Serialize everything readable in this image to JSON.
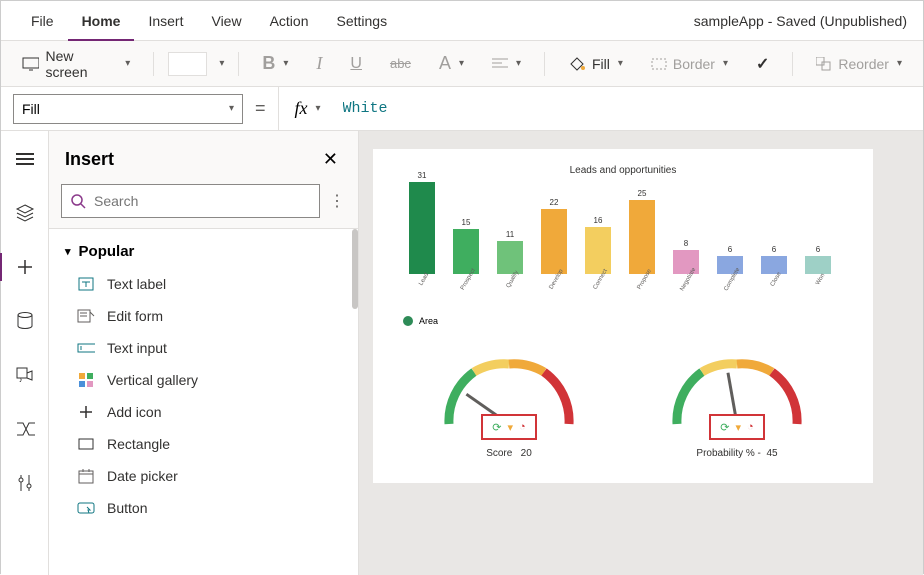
{
  "app_title": "sampleApp - Saved (Unpublished)",
  "menu": {
    "file": "File",
    "home": "Home",
    "insert": "Insert",
    "view": "View",
    "action": "Action",
    "settings": "Settings"
  },
  "ribbon": {
    "new_screen": "New screen",
    "fill": "Fill",
    "border": "Border",
    "reorder": "Reorder"
  },
  "formula": {
    "property": "Fill",
    "value": "White"
  },
  "panel": {
    "title": "Insert",
    "search_placeholder": "Search",
    "group": "Popular",
    "items": [
      "Text label",
      "Edit form",
      "Text input",
      "Vertical gallery",
      "Add icon",
      "Rectangle",
      "Date picker",
      "Button"
    ]
  },
  "chart_data": {
    "type": "bar",
    "title": "Leads and opportunities",
    "categories": [
      "Lead",
      "Prospect",
      "Qualify",
      "Develop",
      "Connect",
      "Propose",
      "Negotiate",
      "Complete",
      "Close",
      "Won"
    ],
    "values": [
      31,
      15,
      11,
      22,
      16,
      25,
      8,
      6,
      6,
      6
    ],
    "colors": [
      "#1f8a4c",
      "#3fae5f",
      "#6fc27a",
      "#f0a93a",
      "#f3ce5f",
      "#f0a93a",
      "#e298c1",
      "#8aa7e0",
      "#8aa7e0",
      "#9ed0c6"
    ],
    "legend": "Area",
    "ylim": [
      0,
      32
    ]
  },
  "gauges": [
    {
      "label": "Score",
      "value": 20,
      "angle": -55
    },
    {
      "label": "Probability %  -",
      "value": 45,
      "angle": -10
    }
  ]
}
